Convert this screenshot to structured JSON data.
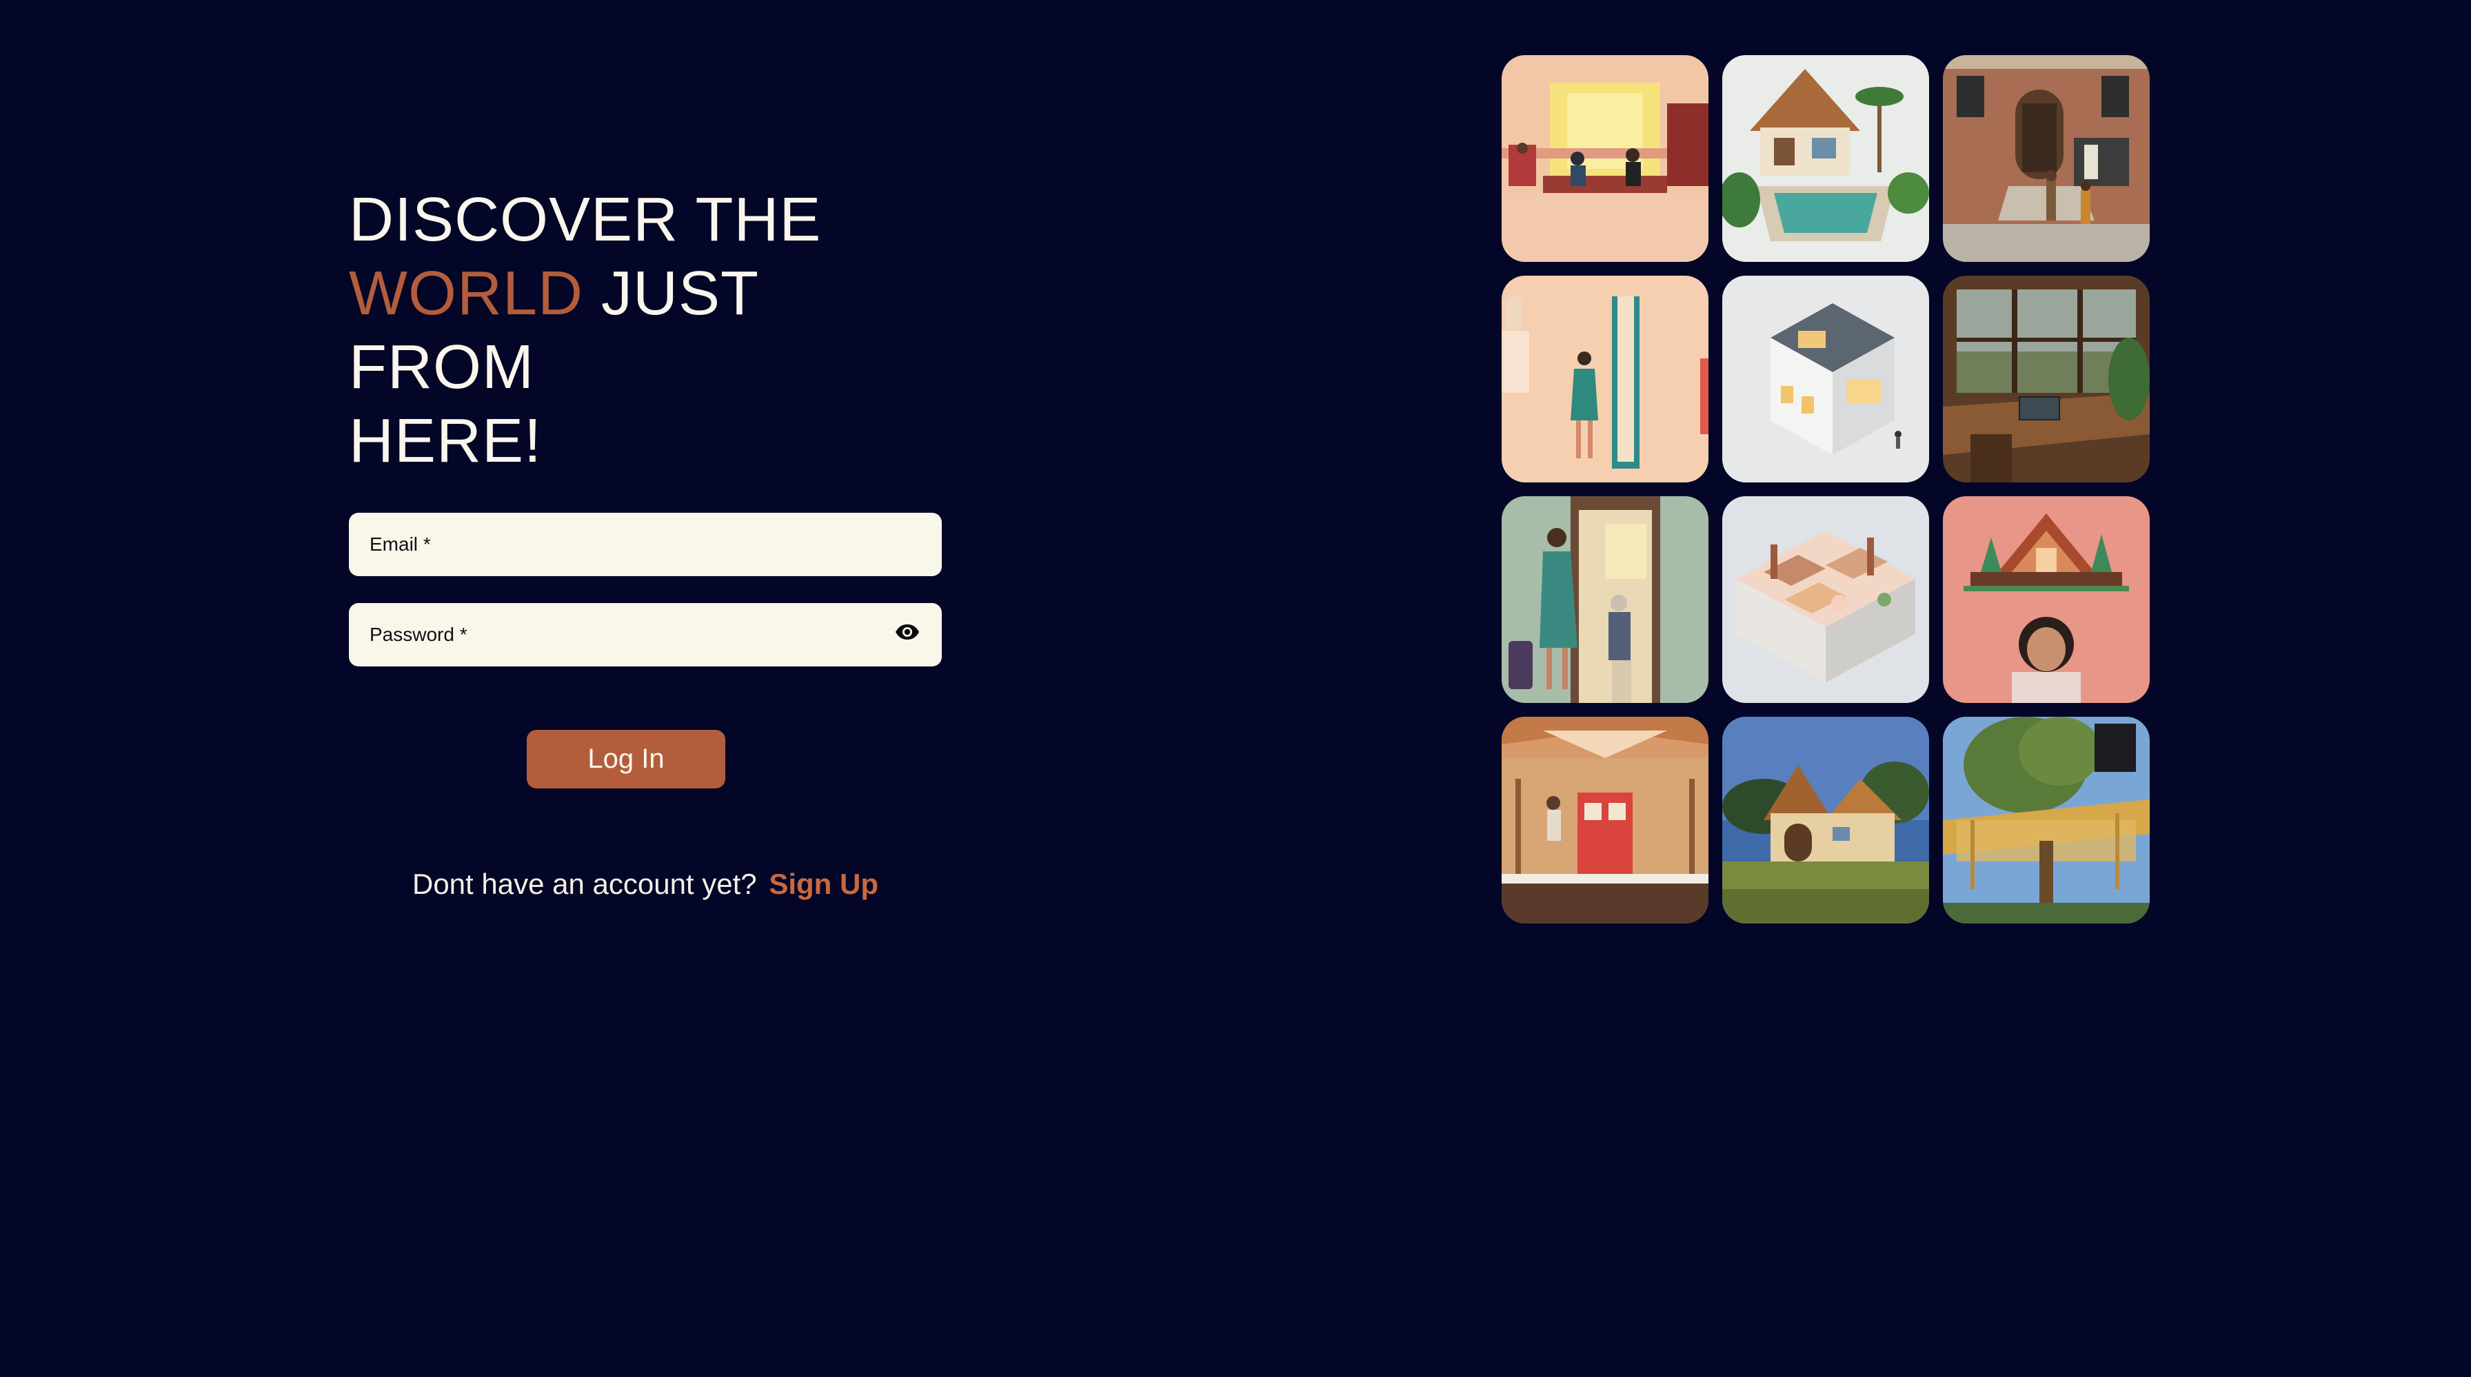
{
  "headline": {
    "line1": "DISCOVER THE",
    "accent": "WORLD",
    "line2_rest": " JUST FROM",
    "line3": "HERE!"
  },
  "form": {
    "email_label": "Email *",
    "password_label": "Password *",
    "password_toggle_icon": "eye-icon",
    "login_label": "Log In"
  },
  "signup": {
    "prompt": "Dont have an account yet?",
    "link_label": "Sign Up"
  },
  "colors": {
    "background": "#030626",
    "accent": "#b35d3c",
    "field_bg": "#f9f6ea",
    "text": "#fbf6ec"
  },
  "gallery": {
    "tiles": [
      {
        "name": "office-meeting-illustration"
      },
      {
        "name": "tropical-pool-house"
      },
      {
        "name": "brick-townhouse-entrance"
      },
      {
        "name": "woman-walking-through-door"
      },
      {
        "name": "isometric-modern-house"
      },
      {
        "name": "home-office-window-view"
      },
      {
        "name": "traveler-at-doorway"
      },
      {
        "name": "isometric-apartment-cutaway"
      },
      {
        "name": "a-frame-cabin-with-woman"
      },
      {
        "name": "log-cabin-front-porch"
      },
      {
        "name": "storybook-cottage"
      },
      {
        "name": "treehouse"
      }
    ]
  }
}
